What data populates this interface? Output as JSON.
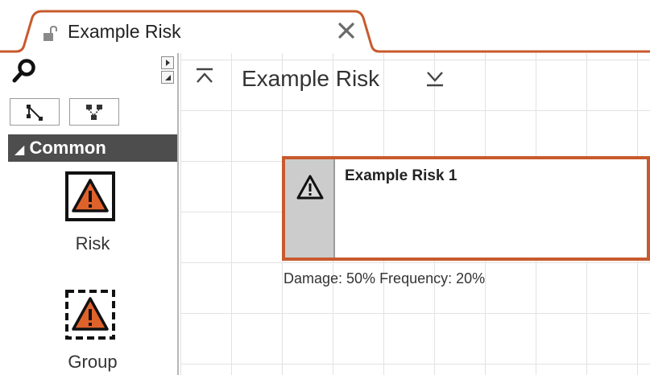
{
  "tab": {
    "title": "Example Risk",
    "accent": "#c85a2d"
  },
  "palette": {
    "section_title": "Common",
    "items": [
      {
        "label": "Risk",
        "icon": "risk-warning-icon"
      },
      {
        "label": "Group",
        "icon": "group-warning-icon"
      }
    ]
  },
  "canvas": {
    "title": "Example Risk",
    "node": {
      "title": "Example Risk 1",
      "meta": "Damage: 50% Frequency: 20%",
      "border_color": "#c85a2d",
      "icon": "warning-icon"
    }
  },
  "colors": {
    "accent": "#c85a2d",
    "section_bg": "#4d4d4d",
    "warning_fill": "#e0622b"
  }
}
